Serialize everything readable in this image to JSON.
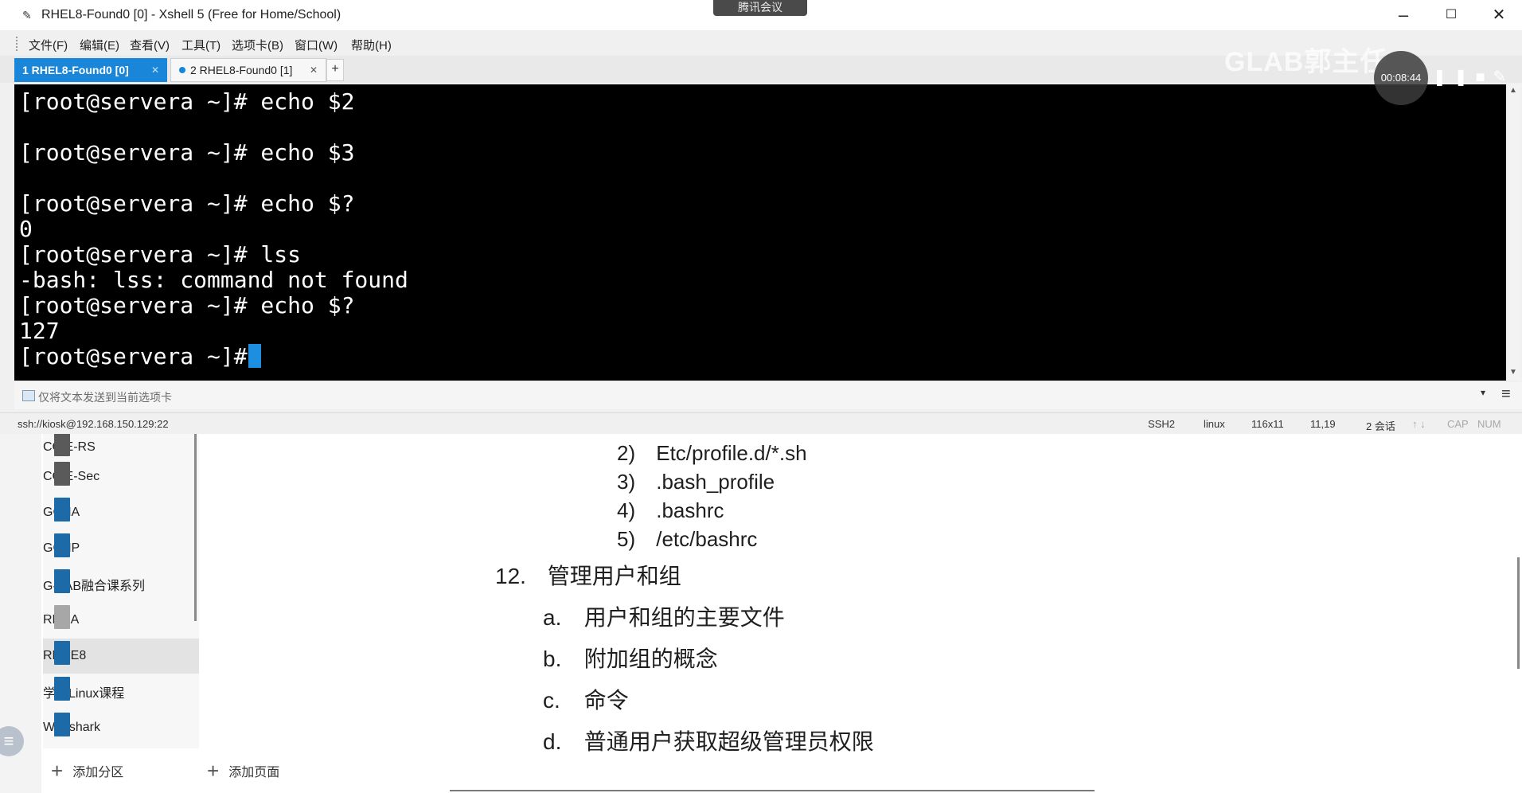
{
  "xshell": {
    "title": "RHEL8-Found0 [0] - Xshell 5 (Free for Home/School)",
    "meeting_badge": "腾讯会议",
    "window_controls": [
      "minimize-icon",
      "maximize-icon",
      "close-icon"
    ],
    "menu": [
      "文件(F)",
      "编辑(E)",
      "查看(V)",
      "工具(T)",
      "选项卡(B)",
      "窗口(W)",
      "帮助(H)"
    ],
    "tabs": [
      {
        "label": "1 RHEL8-Found0 [0]",
        "active": true
      },
      {
        "label": "2 RHEL8-Found0 [1]",
        "active": false
      }
    ],
    "terminal": {
      "lines": [
        "[root@servera ~]# echo $2",
        "",
        "[root@servera ~]# echo $3",
        "",
        "[root@servera ~]# echo $?",
        "0",
        "[root@servera ~]# lss",
        "-bash: lss: command not found",
        "[root@servera ~]# echo $?",
        "127",
        "[root@servera ~]# "
      ],
      "colors": {
        "background": "#000000",
        "foreground": "#ffffff",
        "cursor": "#1e8fe0"
      }
    },
    "send_bar": {
      "placeholder": "仅将文本发送到当前选项卡"
    },
    "status": {
      "connection": "ssh://kiosk@192.168.150.129:22",
      "protocol": "SSH2",
      "term_type": "linux",
      "size": "116x11",
      "cursor_pos": "11,19",
      "sessions": "2 会话",
      "cap": "CAP",
      "num": "NUM"
    },
    "accent": "#1a86d9"
  },
  "overlay": {
    "watermark": "GLAB郭主任",
    "record_time": "00:08:44"
  },
  "notebook": {
    "sections": [
      {
        "label": "CCIE-RS",
        "color": "#5a5a5a"
      },
      {
        "label": "CCIE-Sec",
        "color": "#5a5a5a"
      },
      {
        "label": "GCNA",
        "color": "#1c6aa8"
      },
      {
        "label": "GCNP",
        "color": "#1c6aa8"
      },
      {
        "label": "G-LAB融合课系列",
        "color": "#1c6aa8"
      },
      {
        "label": "RHCA",
        "color": "#a7a7a7"
      },
      {
        "label": "RHCE8",
        "color": "#1c6aa8",
        "selected": true
      },
      {
        "label": "学校Linux课程",
        "color": "#1c6aa8"
      },
      {
        "label": "Wireshark",
        "color": "#1c6aa8"
      }
    ],
    "add_section": "添加分区",
    "add_page": "添加页面",
    "page_lines": {
      "l2": {
        "num": "2)",
        "text": "Etc/profile.d/*.sh"
      },
      "l3": {
        "num": "3)",
        "text": ".bash_profile"
      },
      "l4": {
        "num": "4)",
        "text": ".bashrc"
      },
      "l5": {
        "num": "5)",
        "text": "/etc/bashrc"
      },
      "h12": {
        "num": "12.",
        "text": "管理用户和组"
      },
      "a": {
        "num": "a.",
        "text": "用户和组的主要文件"
      },
      "b": {
        "num": "b.",
        "text": "附加组的概念"
      },
      "c": {
        "num": "c.",
        "text": "命令"
      },
      "d": {
        "num": "d.",
        "text": "普通用户获取超级管理员权限"
      }
    }
  }
}
